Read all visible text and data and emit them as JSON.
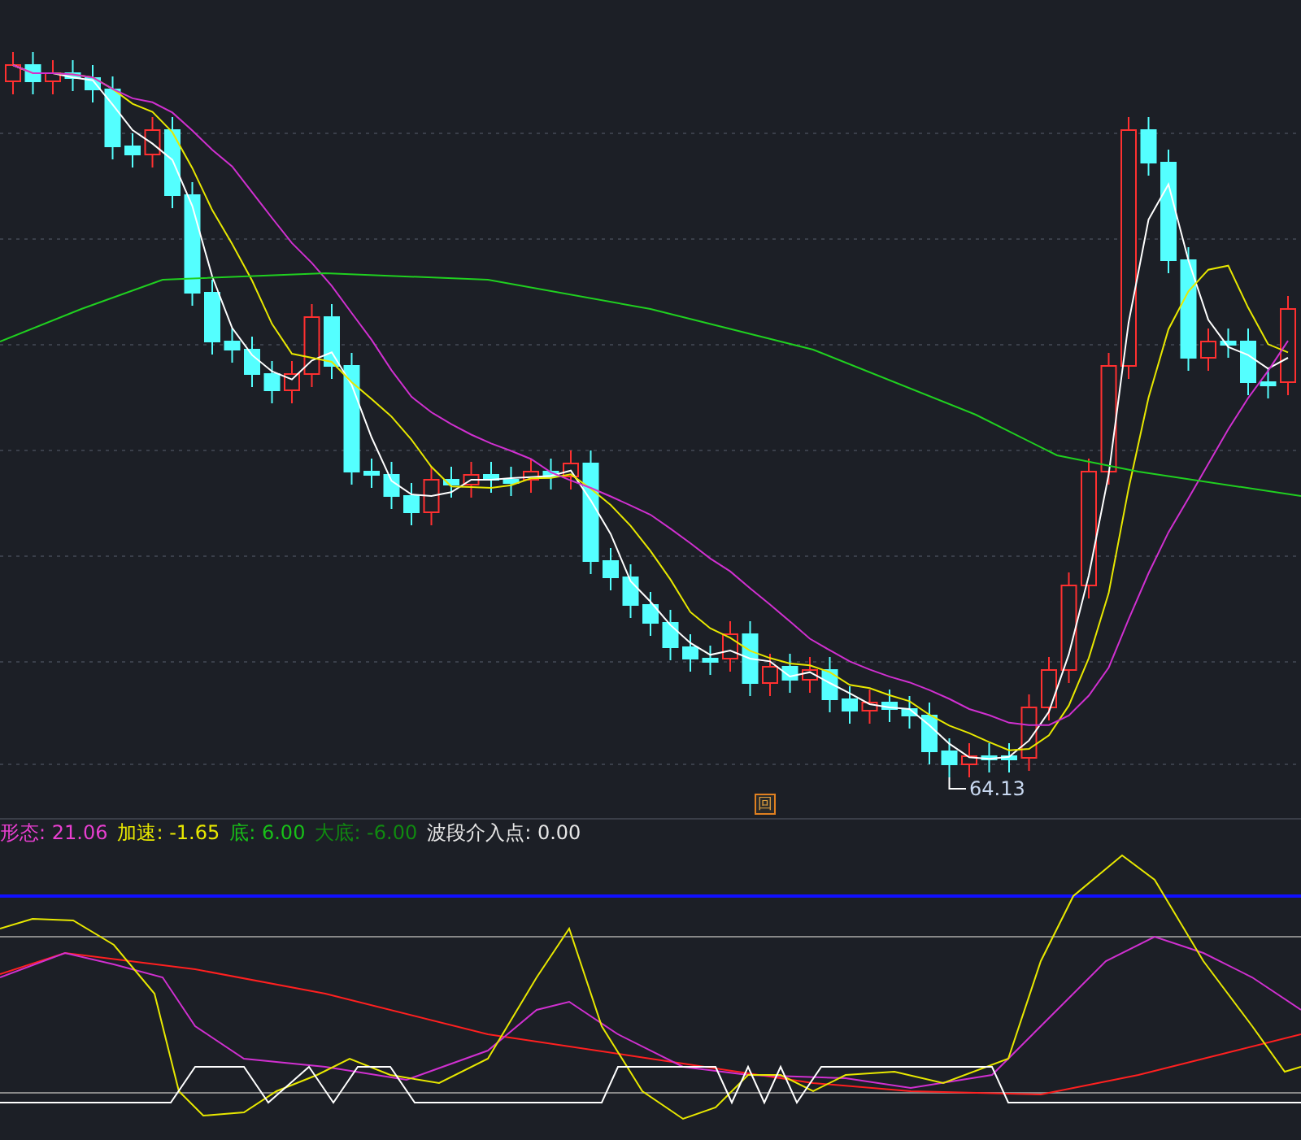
{
  "main_chart": {
    "low_label": "64.13",
    "reset_button": "回"
  },
  "indicator": {
    "values": [
      {
        "label": "形态: 21.06",
        "color": "#e83fd0"
      },
      {
        "label": "加速: -1.65",
        "color": "#e8e800"
      },
      {
        "label": "底: 6.00",
        "color": "#18c018"
      },
      {
        "label": "大底: -6.00",
        "color": "#108a10"
      },
      {
        "label": "波段介入点: 0.00",
        "color": "#e6e6e6"
      }
    ]
  }
}
